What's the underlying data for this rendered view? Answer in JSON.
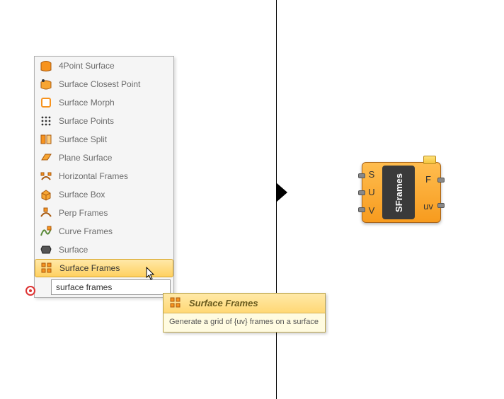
{
  "menu": {
    "items": [
      {
        "label": "4Point Surface",
        "icon": "four-point-surface-icon"
      },
      {
        "label": "Surface Closest Point",
        "icon": "surface-closest-point-icon"
      },
      {
        "label": "Surface Morph",
        "icon": "surface-morph-icon"
      },
      {
        "label": "Surface Points",
        "icon": "surface-points-icon"
      },
      {
        "label": "Surface Split",
        "icon": "surface-split-icon"
      },
      {
        "label": "Plane Surface",
        "icon": "plane-surface-icon"
      },
      {
        "label": "Horizontal Frames",
        "icon": "horizontal-frames-icon"
      },
      {
        "label": "Surface Box",
        "icon": "surface-box-icon"
      },
      {
        "label": "Perp Frames",
        "icon": "perp-frames-icon"
      },
      {
        "label": "Curve Frames",
        "icon": "curve-frames-icon"
      },
      {
        "label": "Surface",
        "icon": "surface-icon"
      },
      {
        "label": "Surface Frames",
        "icon": "surface-frames-icon"
      }
    ],
    "selected_index": 11,
    "search_value": "surface frames"
  },
  "tooltip": {
    "title": "Surface Frames",
    "description": "Generate a grid of {uv} frames on a surface"
  },
  "component": {
    "name": "SFrames",
    "inputs": [
      "S",
      "U",
      "V"
    ],
    "outputs": [
      "F",
      "uv"
    ]
  }
}
